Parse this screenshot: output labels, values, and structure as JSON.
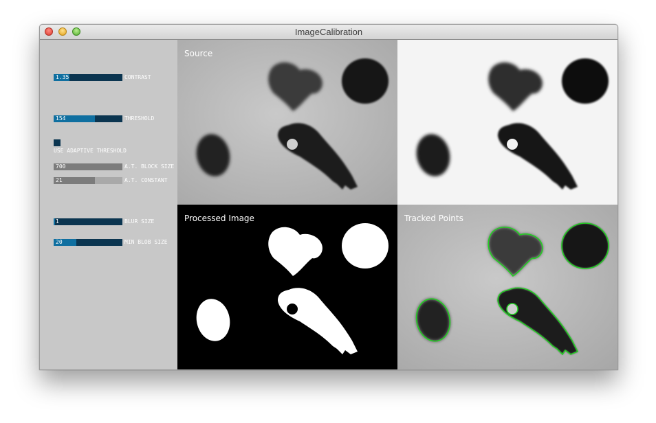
{
  "window": {
    "title": "ImageCalibration"
  },
  "controls": {
    "contrast": {
      "label": "CONTRAST",
      "value": "1.35",
      "fraction": 0.23
    },
    "threshold": {
      "label": "THRESHOLD",
      "value": "154",
      "fraction": 0.6
    },
    "adaptive": {
      "label": "USE ADAPTIVE THRESHOLD",
      "checked": false
    },
    "block_size": {
      "label": "A.T. BLOCK SIZE",
      "value": "700",
      "fraction": 1.0
    },
    "constant": {
      "label": "A.T. CONSTANT",
      "value": "21",
      "fraction": 0.6
    },
    "blur": {
      "label": "BLUR SIZE",
      "value": "1",
      "fraction": 0.02
    },
    "min_blob": {
      "label": "MIN BLOB SIZE",
      "value": "20",
      "fraction": 0.33
    }
  },
  "views": {
    "source": {
      "label": "Source"
    },
    "corrected": {
      "label": ""
    },
    "processed": {
      "label": "Processed Image"
    },
    "tracked": {
      "label": "Tracked Points"
    }
  },
  "colors": {
    "slider_track": "#0b3550",
    "slider_fill": "#0f6fa0",
    "tracked_outline": "#22d022"
  }
}
